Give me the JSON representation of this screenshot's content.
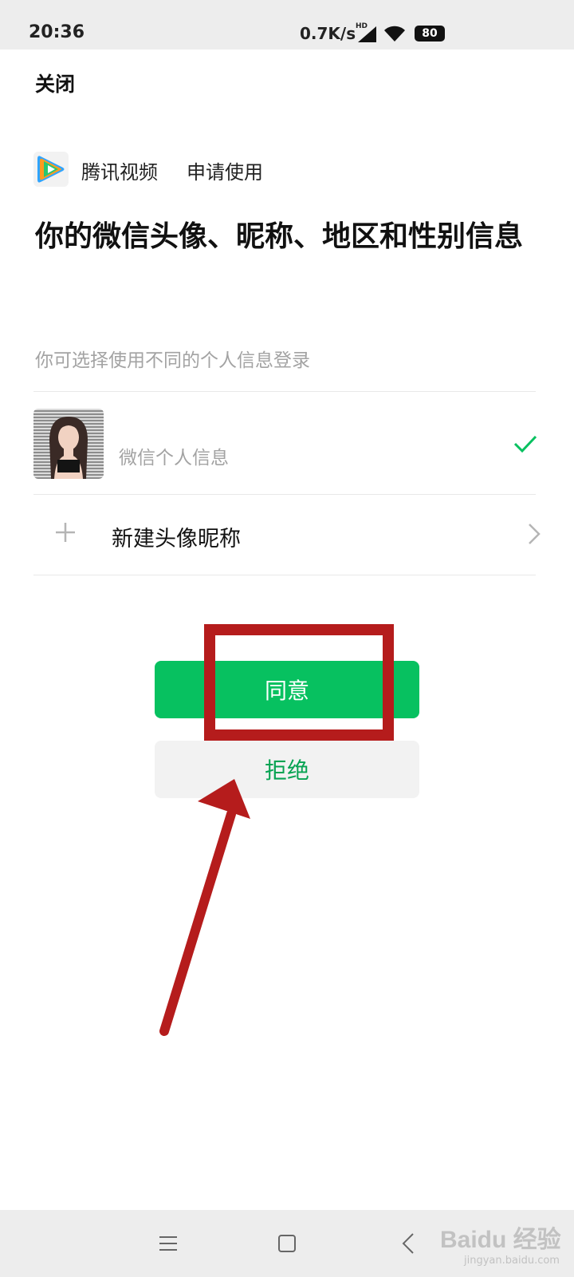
{
  "status_bar": {
    "time": "20:36",
    "network_speed": "0.7K/s",
    "network_type": "HD",
    "battery": "80"
  },
  "header": {
    "close_label": "关闭"
  },
  "app": {
    "name": "腾讯视频",
    "request_text": "申请使用",
    "logo_icon": "tencent-video-logo"
  },
  "heading": "你的微信头像、昵称、地区和性别信息",
  "subtitle": "你可选择使用不同的个人信息登录",
  "options": [
    {
      "label": "微信个人信息",
      "selected": true,
      "icon": "check-icon"
    },
    {
      "label": "新建头像昵称",
      "selected": false,
      "icon": "plus-icon"
    }
  ],
  "buttons": {
    "agree": "同意",
    "decline": "拒绝"
  },
  "colors": {
    "accent_green": "#07c160",
    "decline_text_green": "#07a352",
    "annotation_red": "#b51c1c",
    "muted_text": "#a3a3a3"
  },
  "watermark": {
    "main": "Baidu 经验",
    "sub": "jingyan.baidu.com"
  }
}
